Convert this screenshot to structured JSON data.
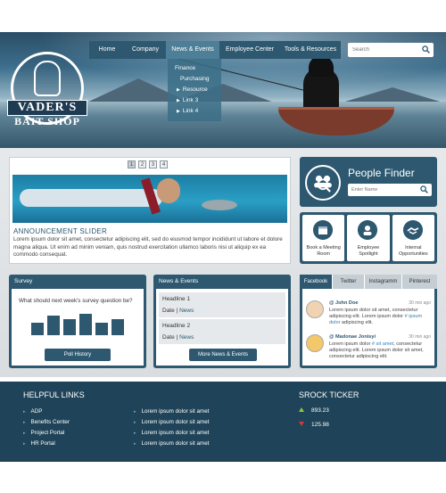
{
  "brand": {
    "line1": "VADER'S",
    "line2": "BAIT SHOP"
  },
  "nav": {
    "items": [
      "Home",
      "Company",
      "News & Events",
      "Employee Center",
      "Tools & Resources"
    ],
    "active": "News & Events",
    "search_placeholder": "Search"
  },
  "dropdown": {
    "items": [
      "Finance",
      "Purchasing",
      "Resource",
      "Link 3",
      "Link 4"
    ]
  },
  "slider": {
    "pages": [
      "1",
      "2",
      "3",
      "4"
    ],
    "title": "ANNOUNCEMENT SLIDER",
    "text": "Lorem ipsum dolor sit amet, consectetur adipiscing elit, sed do eiusmod tempor incididunt ut labore et dolore magna aliqua. Ut enim ad minim veniam, quis nostrud exercitation ullamco laboris nisi ut aliquip ex ea commodo consequat."
  },
  "people_finder": {
    "title": "People Finder",
    "placeholder": "Enter Name"
  },
  "quick_links": [
    {
      "label": "Book a Meeting Room",
      "icon": "calendar-icon"
    },
    {
      "label": "Employee Spotlight",
      "icon": "person-icon"
    },
    {
      "label": "Internal Opportunities",
      "icon": "handshake-icon"
    }
  ],
  "survey": {
    "title": "Survey",
    "question": "What should next week's survey question be?",
    "bars": [
      14,
      22,
      18,
      24,
      14,
      18
    ],
    "button": "Poll History"
  },
  "news": {
    "title": "News & Events",
    "items": [
      {
        "headline": "Headline 1",
        "date": "Date",
        "link": "News"
      },
      {
        "headline": "Headline 2",
        "date": "Date",
        "link": "News"
      }
    ],
    "sep": "|",
    "button": "More News & Events"
  },
  "social": {
    "tabs": [
      "Facebook",
      "Twitter",
      "Instagramm",
      "Pinterest"
    ],
    "active": "Facebook",
    "posts": [
      {
        "user": "@ John Doe",
        "time": "30 min ago",
        "text1": "Lorem ipsum dolor sit amet, consectetur adipiscing elit. Lorem ipsum dolor ",
        "link": "# ipsum dolor",
        "text2": " adipiscing elit."
      },
      {
        "user": "@ Madonae Jonisyi",
        "time": "30 min ago",
        "text1": "Lorem ipsum dolor ",
        "link": "# sit amet",
        "text2": ", consectetur adipiscing elit. Lorem ipsum dolor sit amet, consectetur adipiscing elit."
      }
    ]
  },
  "footer": {
    "links_title": "HELPFUL LINKS",
    "links_col1": [
      "ADP",
      "Benefits Center",
      "Project Portal",
      "HR Portal"
    ],
    "links_col2": [
      "Lorem ipsum dolor sit amet",
      "Lorem ipsum dolor sit amet",
      "Lorem ipsum dolor sit amet",
      "Lorem ipsum dolor sit amet"
    ],
    "ticker_title": "SROCK TICKER",
    "ticker": [
      {
        "value": "893.23",
        "direction": "up",
        "color": "#8ec63f"
      },
      {
        "value": "125.98",
        "direction": "down",
        "color": "#d23a3a"
      }
    ]
  },
  "colors": {
    "primary": "#2d5870",
    "footer": "#1f4358"
  }
}
